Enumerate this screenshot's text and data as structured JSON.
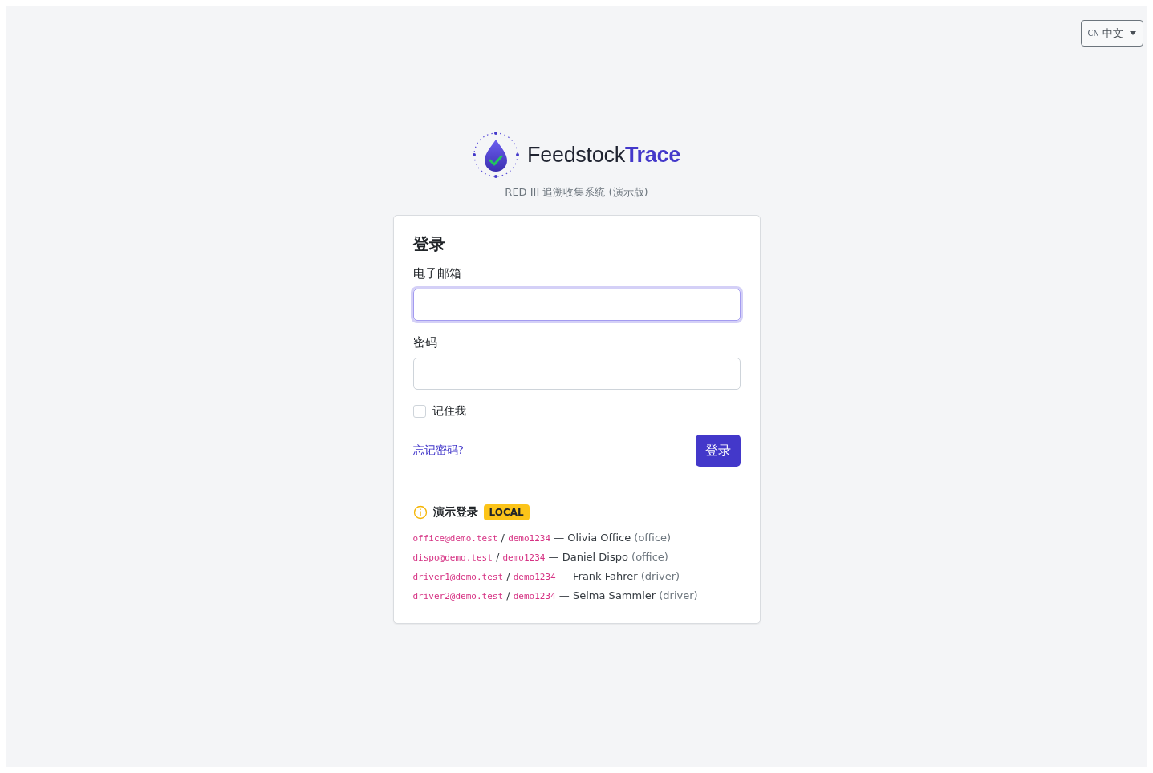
{
  "language": {
    "code": "CN",
    "label": "中文"
  },
  "brand": {
    "name": "Feedstock",
    "accent": "Trace",
    "subtitle": "RED III 追溯收集系统 (演示版)"
  },
  "login": {
    "title": "登录",
    "fields": [
      {
        "label": "电子邮箱",
        "focused": true
      },
      {
        "label": "密码",
        "focused": false
      }
    ],
    "remember": {
      "label": "记住我",
      "checked": false
    },
    "forgot": "忘记密码?",
    "submit": "登录"
  },
  "demo": {
    "title": "演示登录",
    "badge": "LOCAL",
    "accounts": [
      {
        "email": "office@demo.test",
        "separator": "/",
        "password": "demo1234",
        "dash": "—",
        "name": "Olivia Office",
        "role": "(office)"
      },
      {
        "email": "dispo@demo.test",
        "separator": "/",
        "password": "demo1234",
        "dash": "—",
        "name": "Daniel Dispo",
        "role": "(office)"
      },
      {
        "email": "driver1@demo.test",
        "separator": "/",
        "password": "demo1234",
        "dash": "—",
        "name": "Frank Fahrer",
        "role": "(driver)"
      },
      {
        "email": "driver2@demo.test",
        "separator": "/",
        "password": "demo1234",
        "dash": "—",
        "name": "Selma Sammler",
        "role": "(driver)"
      }
    ]
  }
}
